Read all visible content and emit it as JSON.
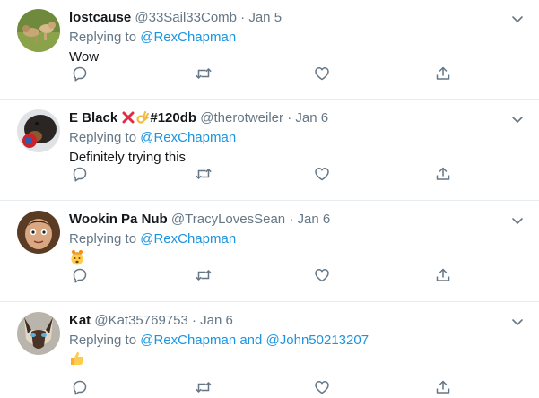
{
  "colors": {
    "link": "#1b95e0",
    "muted": "#657786",
    "text": "#14171a",
    "divider": "#e6ecf0"
  },
  "tweets": [
    {
      "name": "lostcause",
      "handle": "@33Sail33Comb",
      "sep": "·",
      "date": "Jan 5",
      "replying_prefix": "Replying to",
      "mention1": "@RexChapman",
      "text": "Wow",
      "avatar": "dogs-on-grass-photo"
    },
    {
      "name": "E Black",
      "name_suffix": "#120db",
      "name_icons": [
        "cross-mark-icon",
        "ok-hand-icon"
      ],
      "handle": "@therotweiler",
      "sep": "·",
      "date": "Jan 6",
      "replying_prefix": "Replying to",
      "mention1": "@RexChapman",
      "text": "Definitely trying this",
      "avatar": "rottweiler-with-toy-photo"
    },
    {
      "name": "Wookin Pa Nub",
      "handle": "@TracyLovesSean",
      "sep": "·",
      "date": "Jan 6",
      "replying_prefix": "Replying to",
      "mention1": "@RexChapman",
      "text_emoji": "exploding-head-emoji",
      "avatar": "puppet-face-photo"
    },
    {
      "name": "Kat",
      "handle": "@Kat35769753",
      "sep": "·",
      "date": "Jan 6",
      "replying_prefix": "Replying to",
      "mention1": "@RexChapman",
      "joiner": "and",
      "mention2": "@John50213207",
      "text_emoji": "thumbs-up-emoji",
      "avatar": "siamese-cat-photo"
    }
  ],
  "action_icons": [
    "reply-icon",
    "retweet-icon",
    "like-icon",
    "share-icon"
  ]
}
